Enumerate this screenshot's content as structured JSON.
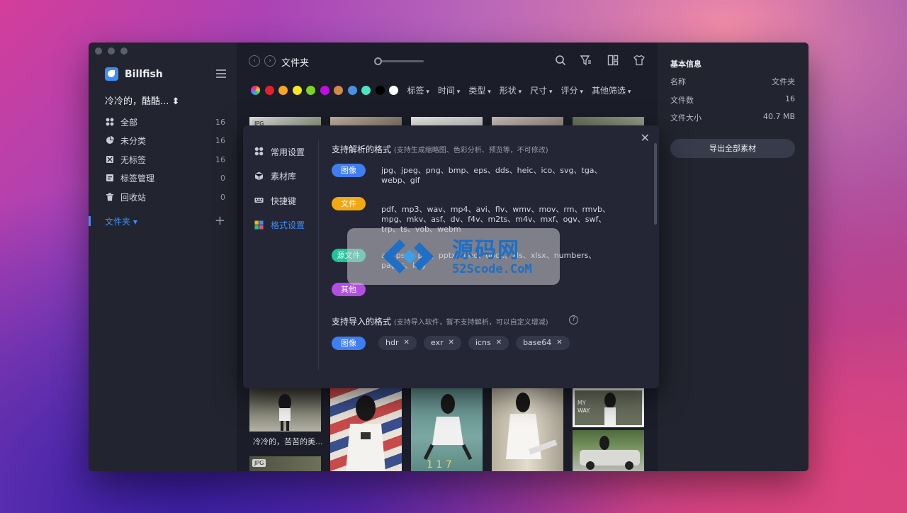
{
  "sidebar": {
    "brand": "Billfish",
    "library": "冷冷的，酷酷... ⬍",
    "items": [
      {
        "label": "全部",
        "count": "16",
        "icon": "grid-icon"
      },
      {
        "label": "未分类",
        "count": "16",
        "icon": "pie-icon"
      },
      {
        "label": "无标签",
        "count": "16",
        "icon": "tag-off-icon"
      },
      {
        "label": "标签管理",
        "count": "0",
        "icon": "tag-manage-icon"
      },
      {
        "label": "回收站",
        "count": "0",
        "icon": "trash-icon"
      }
    ],
    "folder_label": "文件夹 ▾",
    "add_symbol": "+"
  },
  "toolbar": {
    "title": "文件夹",
    "back_symbol": "‹",
    "forward_symbol": "›"
  },
  "filters": {
    "colors": [
      "#e5202c",
      "#f5a623",
      "#f8e71c",
      "#7ed321",
      "#bd10e0",
      "#d08a4a",
      "#4a90e2",
      "#50e3c2",
      "#000000",
      "#ffffff"
    ],
    "labels": [
      "标签",
      "时间",
      "类型",
      "形状",
      "尺寸",
      "评分",
      "其他筛选"
    ]
  },
  "thumbs": {
    "badge": "JPG",
    "caption": "冷冷的，苦苦的美..."
  },
  "info": {
    "title": "基本信息",
    "rows": [
      {
        "key": "名称",
        "value": "文件夹"
      },
      {
        "key": "文件数",
        "value": "16"
      },
      {
        "key": "文件大小",
        "value": "40.7 MB"
      }
    ],
    "export_label": "导出全部素材"
  },
  "settings": {
    "close_symbol": "✕",
    "nav": [
      {
        "label": "常用设置",
        "icon": "settings-icon"
      },
      {
        "label": "素材库",
        "icon": "cube-icon"
      },
      {
        "label": "快捷键",
        "icon": "keyboard-icon"
      },
      {
        "label": "格式设置",
        "icon": "format-icon"
      }
    ],
    "supported_title": "支持解析的格式",
    "supported_note": "(支持生成缩略图、色彩分析、预览等，不可修改)",
    "groups": [
      {
        "tag": "图像",
        "color": "#3f7ef0",
        "formats": "jpg、jpeg、png、bmp、eps、dds、heic、ico、svg、tga、webp、gif"
      },
      {
        "tag": "文件",
        "color": "#f2a813",
        "formats": "pdf、mp3、wav、mp4、avi、flv、wmv、mov、rm、rmvb、mpg、mkv、asf、dv、f4v、m2ts、m4v、mxf、ogv、swf、trp、ts、vob、webm"
      },
      {
        "tag": "源文件",
        "color": "#22c29a",
        "formats": "ai、psd、ppt、pptx、doc、docx、xls、xlsx、numbers、pages、key"
      },
      {
        "tag": "其他",
        "color": "#b34fe0",
        "formats": ""
      }
    ],
    "import_title": "支持导入的格式",
    "import_note": "(支持导入软件，暂不支持解析，可以自定义增减)",
    "help_symbol": "?",
    "import_tag": "图像",
    "import_formats": [
      "hdr",
      "exr",
      "icns",
      "base64"
    ],
    "remove_symbol": "✕"
  },
  "watermark": {
    "cn": "源码网",
    "en": "52Scode.CoM"
  }
}
